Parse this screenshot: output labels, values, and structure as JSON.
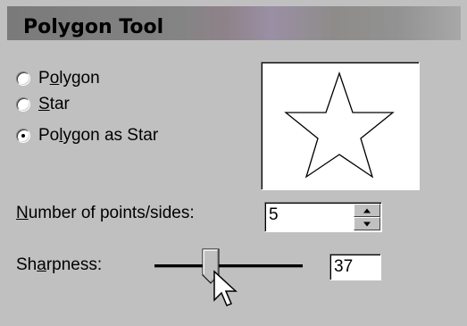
{
  "panel": {
    "title": "Polygon Tool"
  },
  "shape_options": [
    {
      "pre": "P",
      "ul": "o",
      "post": "lygon",
      "checked": false
    },
    {
      "pre": "",
      "ul": "S",
      "post": "tar",
      "checked": false
    },
    {
      "pre": "Po",
      "ul": "l",
      "post": "ygon as Star",
      "checked": true
    }
  ],
  "preview": {
    "shape": "star",
    "points": 5
  },
  "points_sides": {
    "label_ul": "N",
    "label_rest": "umber of points/sides:",
    "value": "5"
  },
  "sharpness": {
    "label_pre": "Sh",
    "label_ul": "a",
    "label_post": "rpness:",
    "value": "37",
    "level": 37
  },
  "icons": {
    "spin_up": "spin-up-arrow-icon",
    "spin_down": "spin-down-arrow-icon",
    "cursor": "mouse-pointer-icon"
  }
}
